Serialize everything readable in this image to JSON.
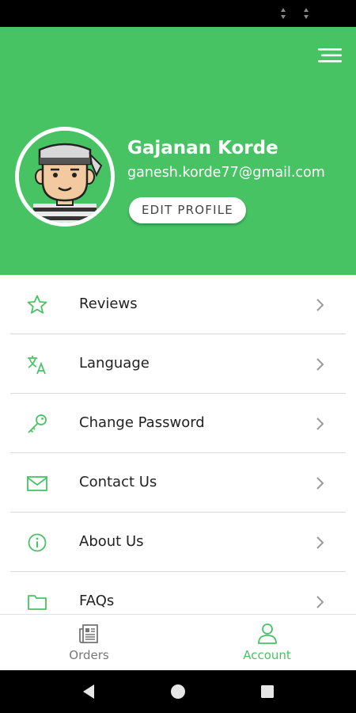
{
  "theme": {
    "accent": "#47c364",
    "header_bg": "#47c364",
    "text": "#222222",
    "divider": "#d9d9d9"
  },
  "status_bar": {
    "icons": [
      "signal-icon",
      "signal-icon"
    ]
  },
  "header": {
    "menu_icon": "hamburger-menu-icon",
    "profile": {
      "avatar_icon": "chef-avatar-icon",
      "name": "Gajanan Korde",
      "email": "ganesh.korde77@gmail.com",
      "edit_button": "EDIT PROFILE"
    }
  },
  "menu": {
    "items": [
      {
        "icon": "star-icon",
        "label": "Reviews"
      },
      {
        "icon": "translate-icon",
        "label": "Language"
      },
      {
        "icon": "key-icon",
        "label": "Change Password"
      },
      {
        "icon": "mail-icon",
        "label": "Contact Us"
      },
      {
        "icon": "info-icon",
        "label": "About Us"
      },
      {
        "icon": "folder-icon",
        "label": "FAQs"
      }
    ],
    "chevron_icon": "chevron-right-icon"
  },
  "bottom_nav": {
    "tabs": [
      {
        "icon": "orders-icon",
        "label": "Orders",
        "active": false
      },
      {
        "icon": "account-icon",
        "label": "Account",
        "active": true
      }
    ]
  },
  "system_nav": {
    "buttons": [
      "back-icon",
      "home-icon",
      "recents-icon"
    ]
  }
}
